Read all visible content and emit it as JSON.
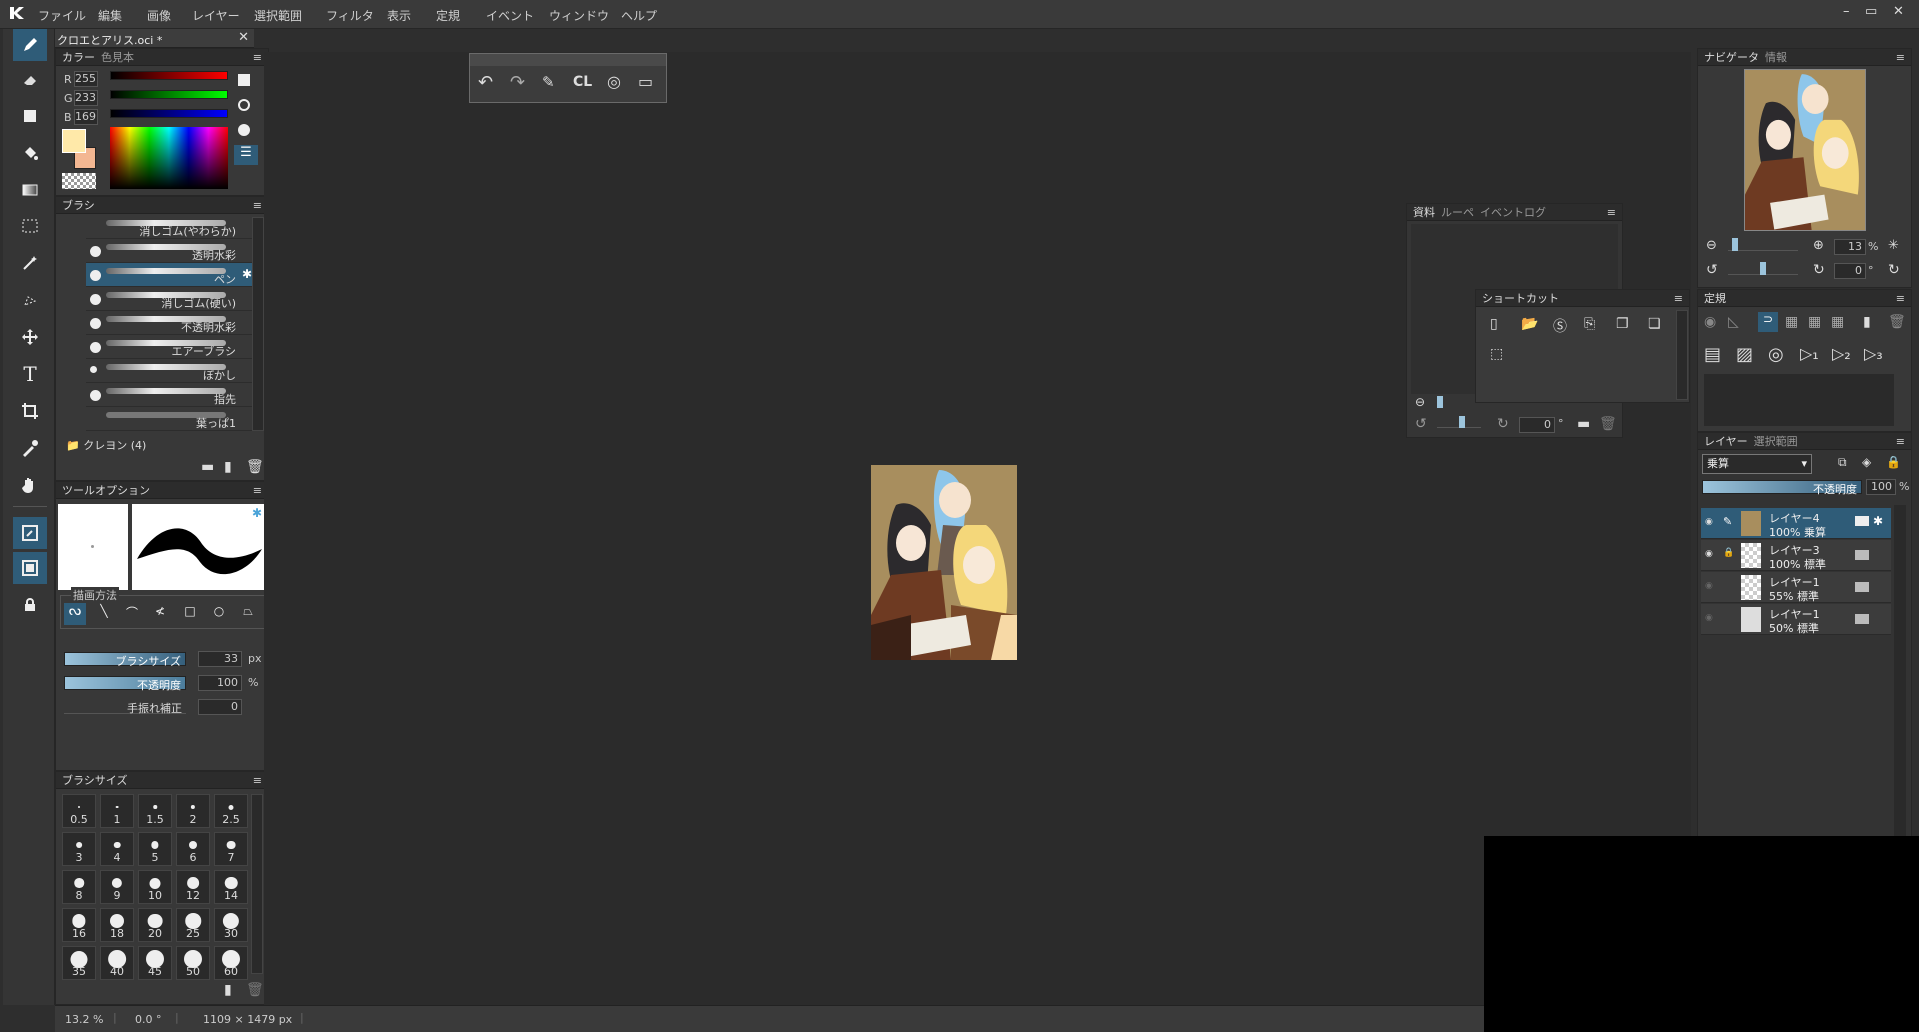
{
  "menubar": {
    "items": [
      "ファイル",
      "編集",
      "画像",
      "レイヤー",
      "選択範囲",
      "フィルタ",
      "表示",
      "定規",
      "イベント",
      "ウィンドウ",
      "ヘルプ"
    ],
    "window_controls": [
      "–",
      "▭",
      "✕"
    ]
  },
  "document_tab": {
    "title": "クロエとアリス.oci *"
  },
  "color_panel": {
    "tabs": [
      "カラー",
      "色見本"
    ],
    "r_label": "R",
    "r_value": "255",
    "g_label": "G",
    "g_value": "233",
    "b_label": "B",
    "b_value": "169",
    "foreground_color": "#ffe9a9",
    "background_color": "#f3b792"
  },
  "brush_panel": {
    "title": "ブラシ",
    "items": [
      {
        "label": "消しゴム(やわらか)"
      },
      {
        "label": "透明水彩"
      },
      {
        "label": "ペン"
      },
      {
        "label": "消しゴム(硬い)"
      },
      {
        "label": "不透明水彩"
      },
      {
        "label": "エアーブラシ"
      },
      {
        "label": "ぼかし"
      },
      {
        "label": "指先"
      },
      {
        "label": "葉っぱ1"
      }
    ],
    "group_label": "クレヨン (4)"
  },
  "tool_option_panel": {
    "title": "ツールオプション",
    "draw_method_label": "描画方法",
    "brush_size_label": "ブラシサイズ",
    "brush_size_value": "33",
    "brush_size_unit": "px",
    "opacity_label": "不透明度",
    "opacity_value": "100",
    "opacity_unit": "%",
    "stabilizer_label": "手振れ補正",
    "stabilizer_value": "0"
  },
  "brush_size_panel": {
    "title": "ブラシサイズ",
    "sizes": [
      "0.5",
      "1",
      "1.5",
      "2",
      "2.5",
      "3",
      "4",
      "5",
      "6",
      "7",
      "8",
      "9",
      "10",
      "12",
      "14",
      "16",
      "18",
      "20",
      "25",
      "30",
      "35",
      "40",
      "45",
      "50",
      "60"
    ]
  },
  "floating_toolbar": {
    "cl_label": "CL"
  },
  "material_panel": {
    "tabs": [
      "資料",
      "ルーペ",
      "イベントログ"
    ],
    "rotate_value": "0",
    "rotate_unit": "°"
  },
  "shortcut_panel": {
    "title": "ショートカット"
  },
  "navigator_panel": {
    "tabs": [
      "ナビゲータ",
      "情報"
    ],
    "zoom_value": "13",
    "zoom_unit": "%",
    "rotate_value": "0",
    "rotate_unit": "°"
  },
  "ruler_panel": {
    "title": "定規"
  },
  "layer_panel": {
    "tabs": [
      "レイヤー",
      "選択範囲"
    ],
    "blend_mode": "乗算",
    "opacity_label": "不透明度",
    "opacity_value": "100",
    "opacity_unit": "%",
    "layers": [
      {
        "name": "レイヤー4",
        "sub": "100% 乗算"
      },
      {
        "name": "レイヤー3",
        "sub": "100% 標準"
      },
      {
        "name": "レイヤー1",
        "sub": "55% 標準"
      },
      {
        "name": "レイヤー1",
        "sub": "50% 標準"
      }
    ]
  },
  "statusbar": {
    "zoom": "13.2 %",
    "angle": "0.0 °",
    "size": "1109 × 1479 px"
  }
}
